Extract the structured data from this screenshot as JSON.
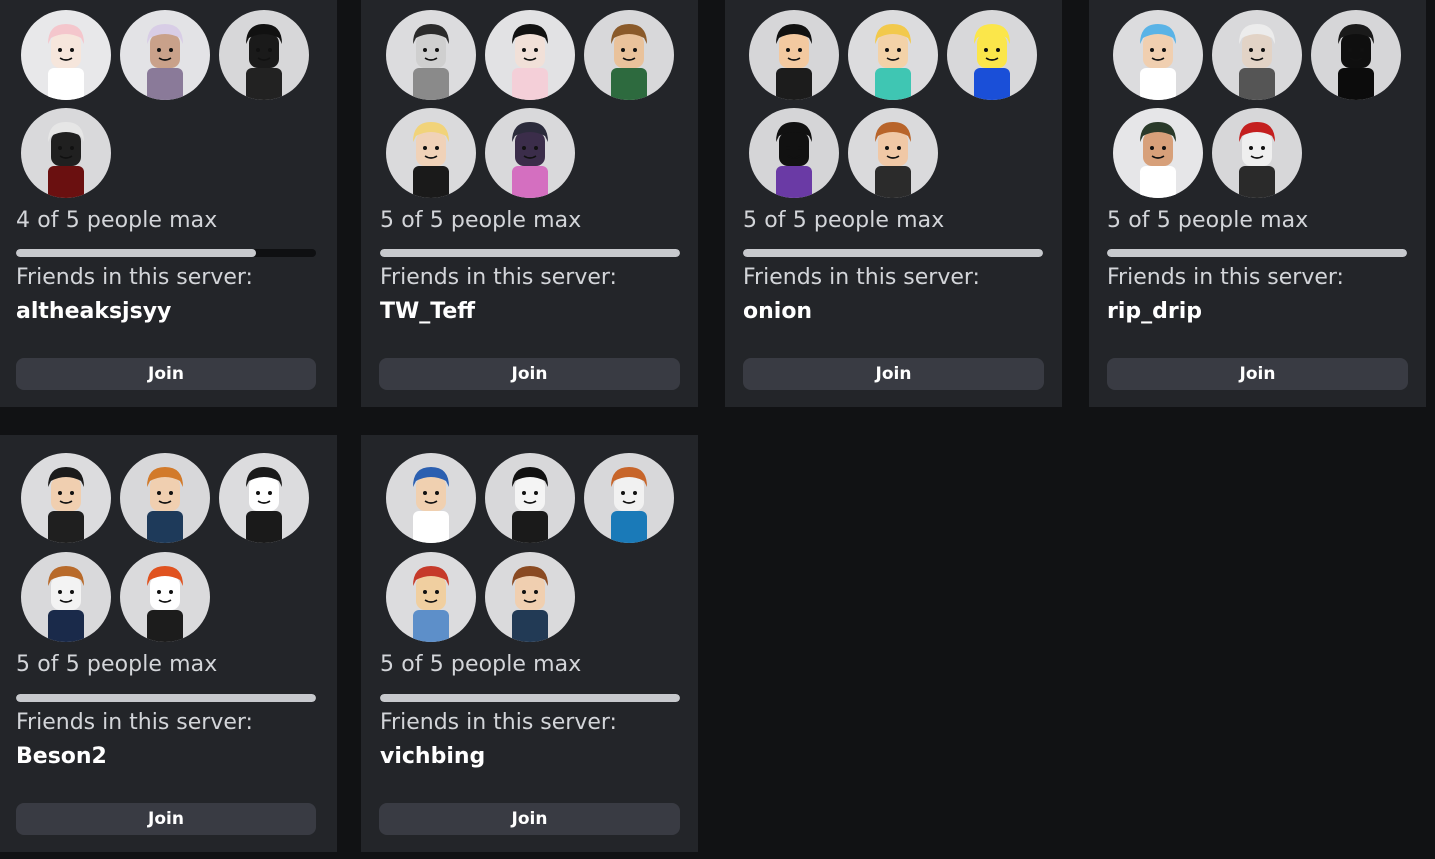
{
  "servers": [
    {
      "people": "4 of 5 people max",
      "fill": 0.8,
      "friends_label": "Friends in this server:",
      "friend": "altheaksjsyy",
      "join_label": "Join",
      "avatars": [
        {
          "name": "pink-hair-avatar",
          "bg": "#e8e8ea",
          "skin": "#f6e6dc",
          "hair": "#f4c6cc",
          "body": "#ffffff"
        },
        {
          "name": "lavender-hair-avatar",
          "bg": "#e3e3e6",
          "skin": "#c9a18a",
          "hair": "#d8cde6",
          "body": "#8a7a99"
        },
        {
          "name": "black-hat-avatar",
          "bg": "#d7d7d9",
          "skin": "#1a1a1a",
          "hair": "#111111",
          "body": "#222222"
        },
        {
          "name": "horned-helmet-avatar",
          "bg": "#d9d9db",
          "skin": "#202020",
          "hair": "#e6e6e6",
          "body": "#6a1010"
        }
      ]
    },
    {
      "people": "5 of 5 people max",
      "fill": 1,
      "friends_label": "Friends in this server:",
      "friend": "TW_Teff",
      "join_label": "Join",
      "avatars": [
        {
          "name": "messy-black-hair-avatar",
          "bg": "#dcdcde",
          "skin": "#cfcfcf",
          "hair": "#2a2a2a",
          "body": "#8a8a8a"
        },
        {
          "name": "long-black-hair-avatar",
          "bg": "#e2e2e4",
          "skin": "#f1e0d8",
          "hair": "#111111",
          "body": "#f4cfd8"
        },
        {
          "name": "green-outfit-avatar",
          "bg": "#d8d8da",
          "skin": "#e9c29b",
          "hair": "#8a5a2a",
          "body": "#2d6a3e"
        },
        {
          "name": "blonde-black-dress-avatar",
          "bg": "#dadadc",
          "skin": "#f0d2b8",
          "hair": "#f1d37a",
          "body": "#1a1a1a"
        },
        {
          "name": "pink-butterfly-avatar",
          "bg": "#d9d9db",
          "skin": "#3b2d4a",
          "hair": "#2b2b3b",
          "body": "#d46fc0"
        }
      ]
    },
    {
      "people": "5 of 5 people max",
      "fill": 1,
      "friends_label": "Friends in this server:",
      "friend": "onion",
      "join_label": "Join",
      "avatars": [
        {
          "name": "fedora-sunglasses-avatar",
          "bg": "#d6d6d8",
          "skin": "#f3c9a0",
          "hair": "#111111",
          "body": "#1c1c1c"
        },
        {
          "name": "blonde-teal-shirt-avatar",
          "bg": "#dcdcde",
          "skin": "#f3d2a8",
          "hair": "#f2c94c",
          "body": "#3fc6b3"
        },
        {
          "name": "classic-smiley-avatar",
          "bg": "#d8d8da",
          "skin": "#fbe64a",
          "hair": "#fbe64a",
          "body": "#1a4fd8"
        },
        {
          "name": "top-hat-purple-avatar",
          "bg": "#d5d5d7",
          "skin": "#111111",
          "hair": "#111111",
          "body": "#6a3aa5"
        },
        {
          "name": "glasses-brown-hair-avatar",
          "bg": "#dadadc",
          "skin": "#f0c8a6",
          "hair": "#b8642a",
          "body": "#2b2b2b"
        }
      ]
    },
    {
      "people": "5 of 5 people max",
      "fill": 1,
      "friends_label": "Friends in this server:",
      "friend": "rip_drip",
      "join_label": "Join",
      "avatars": [
        {
          "name": "blue-hair-avatar",
          "bg": "#dcdcde",
          "skin": "#f0cfb0",
          "hair": "#5ab3e6",
          "body": "#ffffff"
        },
        {
          "name": "white-hair-sign-avatar",
          "bg": "#d9d9db",
          "skin": "#e2d3c6",
          "hair": "#ececec",
          "body": "#555555"
        },
        {
          "name": "red-fedora-shadow-avatar",
          "bg": "#d6d6d8",
          "skin": "#0f0f0f",
          "hair": "#1a1a1a",
          "body": "#0c0c0c"
        },
        {
          "name": "goggles-long-neck-avatar",
          "bg": "#e6e6e8",
          "skin": "#d7a07a",
          "hair": "#2a3a2a",
          "body": "#ffffff"
        },
        {
          "name": "red-cap-avatar",
          "bg": "#d7d7d9",
          "skin": "#efefef",
          "hair": "#c41f1f",
          "body": "#2a2a2a"
        }
      ]
    },
    {
      "people": "5 of 5 people max",
      "fill": 1,
      "friends_label": "Friends in this server:",
      "friend": "Beson2",
      "join_label": "Join",
      "avatars": [
        {
          "name": "dancing-black-outfit-avatar",
          "bg": "#dcdcde",
          "skin": "#f0cfb0",
          "hair": "#1b1b1b",
          "body": "#1f1f1f"
        },
        {
          "name": "orange-hair-avatar",
          "bg": "#d8d8da",
          "skin": "#f0cfb0",
          "hair": "#d27a2a",
          "body": "#1e3a5a"
        },
        {
          "name": "penguin-avatar",
          "bg": "#dcdcde",
          "skin": "#ffffff",
          "hair": "#1a1a1a",
          "body": "#1a1a1a"
        },
        {
          "name": "waving-brown-hair-avatar",
          "bg": "#d9d9db",
          "skin": "#f3f3f3",
          "hair": "#b86a2a",
          "body": "#1a2a4a"
        },
        {
          "name": "red-hair-ready-shirt-avatar",
          "bg": "#dadadc",
          "skin": "#ffffff",
          "hair": "#e0521f",
          "body": "#1c1c1c"
        }
      ]
    },
    {
      "people": "5 of 5 people max",
      "fill": 1,
      "friends_label": "Friends in this server:",
      "friend": "vichbing",
      "join_label": "Join",
      "avatars": [
        {
          "name": "blue-hair-glasses-avatar",
          "bg": "#dadadc",
          "skin": "#f0d0b0",
          "hair": "#2b5fb0",
          "body": "#ffffff"
        },
        {
          "name": "black-spiky-hair-avatar",
          "bg": "#d8d8da",
          "skin": "#f4f4f4",
          "hair": "#111111",
          "body": "#1a1a1a"
        },
        {
          "name": "big-orange-hair-avatar",
          "bg": "#d8d8da",
          "skin": "#f1f1f1",
          "hair": "#c7652a",
          "body": "#1a7ab8"
        },
        {
          "name": "red-cap-denim-avatar",
          "bg": "#dcdcde",
          "skin": "#f0cfa0",
          "hair": "#c63a2a",
          "body": "#5d8fc9"
        },
        {
          "name": "brown-hair-cheering-avatar",
          "bg": "#dadadc",
          "skin": "#f0cfb0",
          "hair": "#8a4a22",
          "body": "#223a55"
        }
      ]
    }
  ]
}
